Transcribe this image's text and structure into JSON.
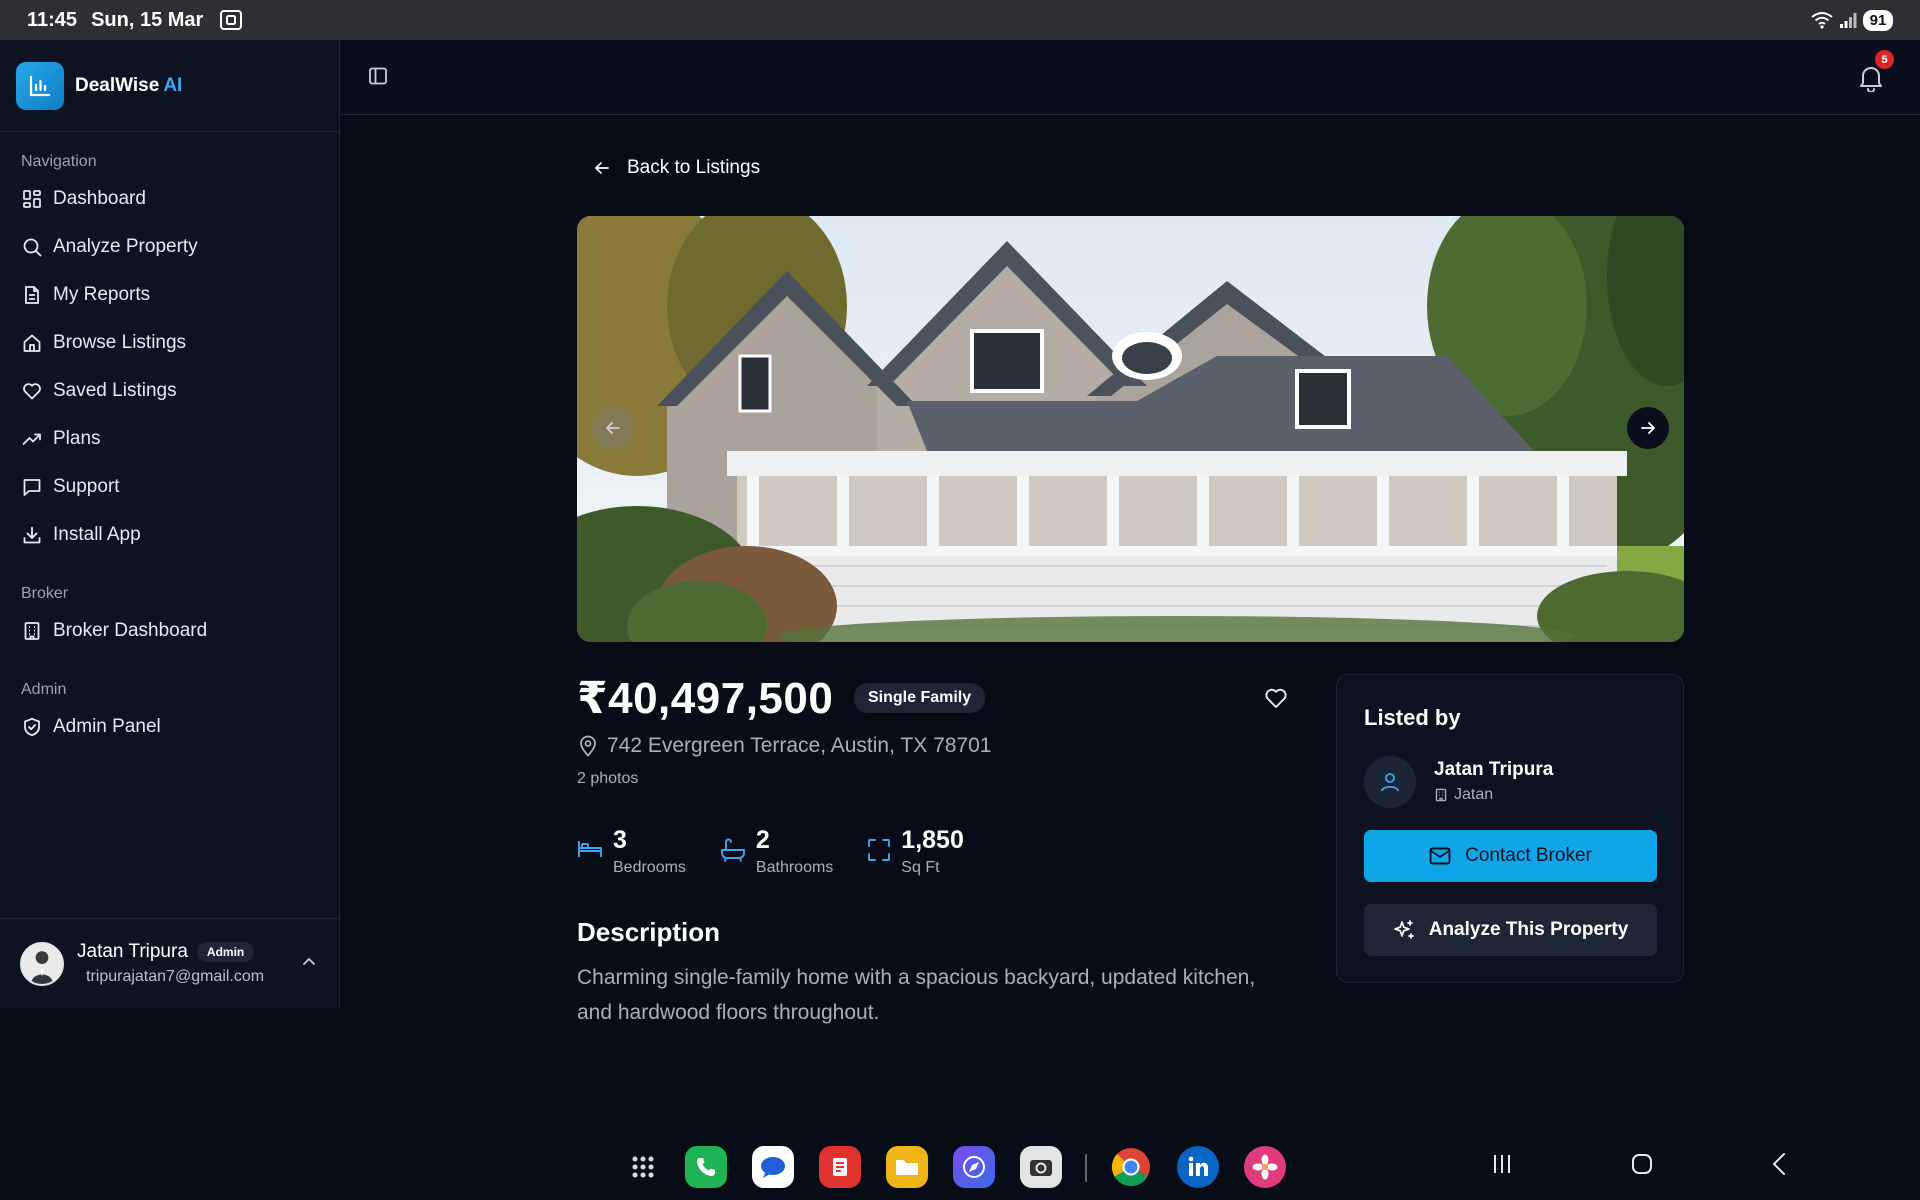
{
  "status_bar": {
    "time": "11:45",
    "date": "Sun, 15 Mar",
    "battery": "91"
  },
  "sidebar": {
    "brand": {
      "name": "DealWise",
      "suffix": "AI"
    },
    "sections": [
      {
        "title": "Navigation",
        "items": [
          {
            "label": "Dashboard",
            "icon": "dashboard-icon"
          },
          {
            "label": "Analyze Property",
            "icon": "search-icon"
          },
          {
            "label": "My Reports",
            "icon": "document-icon"
          },
          {
            "label": "Browse Listings",
            "icon": "home-icon"
          },
          {
            "label": "Saved Listings",
            "icon": "heart-icon"
          },
          {
            "label": "Plans",
            "icon": "trending-up-icon"
          },
          {
            "label": "Support",
            "icon": "chat-icon"
          },
          {
            "label": "Install App",
            "icon": "download-icon"
          }
        ]
      },
      {
        "title": "Broker",
        "items": [
          {
            "label": "Broker Dashboard",
            "icon": "building-icon"
          }
        ]
      },
      {
        "title": "Admin",
        "items": [
          {
            "label": "Admin Panel",
            "icon": "shield-check-icon"
          }
        ]
      }
    ],
    "user": {
      "name": "Jatan Tripura",
      "role": "Admin",
      "email": "tripurajatan7@gmail.com"
    }
  },
  "topbar": {
    "notification_count": "5"
  },
  "listing": {
    "back_label": "Back to Listings",
    "price": "₹40,497,500",
    "property_type": "Single Family",
    "address": "742 Evergreen Terrace, Austin, TX 78701",
    "photo_count": "2 photos",
    "stats": [
      {
        "value": "3",
        "label": "Bedrooms",
        "icon": "bed-icon"
      },
      {
        "value": "2",
        "label": "Bathrooms",
        "icon": "bath-icon"
      },
      {
        "value": "1,850",
        "label": "Sq Ft",
        "icon": "area-icon"
      }
    ],
    "description_title": "Description",
    "description": "Charming single-family home with a spacious backyard, updated kitchen, and hardwood floors throughout."
  },
  "listed_by": {
    "title": "Listed by",
    "broker_name": "Jatan Tripura",
    "broker_company": "Jatan",
    "contact_label": "Contact Broker",
    "analyze_label": "Analyze This Property"
  },
  "colors": {
    "background": "#080c16",
    "accent": "#0ea5e9",
    "brand_ai": "#3aa8f0",
    "badge_red": "#dc2626"
  },
  "dock": {
    "apps": [
      "app-drawer-icon",
      "phone-icon",
      "messages-icon",
      "notes-icon",
      "files-icon",
      "browser-icon",
      "camera-icon",
      "chrome-icon",
      "linkedin-icon",
      "gallery-icon"
    ]
  }
}
